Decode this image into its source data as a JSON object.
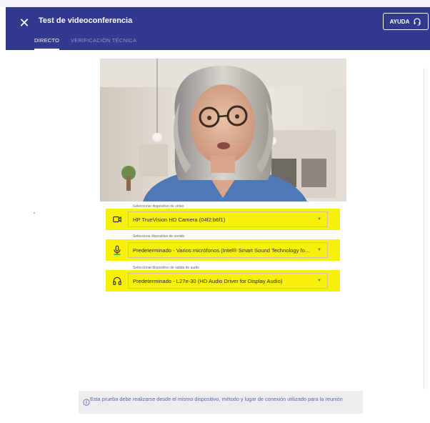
{
  "window": {
    "title": "Test de videoconferencia",
    "help_label": "AYUDA",
    "tabs": [
      {
        "label": "DIRECTO",
        "active": true
      },
      {
        "label": "VERIFICACIÓN TÉCNICA",
        "active": false
      }
    ]
  },
  "colors": {
    "header_bg": "#323a8f",
    "highlight": "#f6f00b",
    "notice_bg": "#eceded",
    "notice_text": "#5a66b7"
  },
  "devices": {
    "video": {
      "label": "Seleccionar dispositivo de vídeo",
      "value": "HP TrueVision HD Camera (04f2:b6f1)",
      "icon": "camera-icon"
    },
    "sound": {
      "label": "Selecciona dispositivo de sonido",
      "value": "Predeterminado - Varios micrófonos (Intel® Smart Sound Technology fo...",
      "icon": "microphone-icon"
    },
    "audio_out": {
      "label": "Seleccionar dispositivo de salida de audio",
      "value": "Predeterminado - L27e-30 (HD Audio Driver for Display Audio)",
      "icon": "headphones-icon"
    }
  },
  "notice": {
    "text": "Esta prueba debe realizarse desde el mismo dispositivo, método y lugar de conexión utilizado para la reunión",
    "icon": "info-icon"
  }
}
